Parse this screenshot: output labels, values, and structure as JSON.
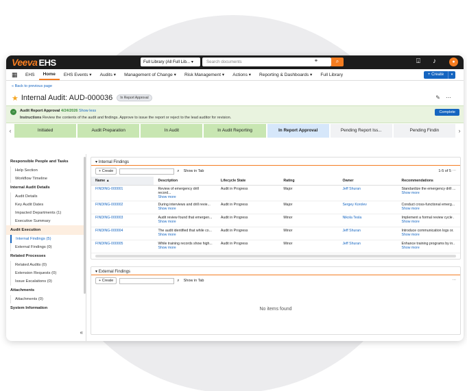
{
  "app": {
    "brand_veeva": "Veeva",
    "brand_ehs": "EHS"
  },
  "topbar": {
    "library": "Full Library (All Full Lib...",
    "search_placeholder": "Search documents"
  },
  "nav": {
    "items": [
      "EHS",
      "Home",
      "EHS Events ▾",
      "Audits ▾",
      "Management of Change ▾",
      "Risk Management ▾",
      "Actions ▾",
      "Reporting & Dashboards ▾",
      "Full Library"
    ],
    "create": "+ Create"
  },
  "page": {
    "back": "« Back to previous page",
    "title": "Internal Audit: AUD-000036",
    "badge": "In Report Approval"
  },
  "approval": {
    "label": "Audit Report Approval",
    "date": "4/24/2026",
    "show_less": "Show less",
    "instructions_label": "Instructions",
    "instructions": "Review the contents of the audit and findings. Approve to issue the report or reject to the lead auditor for revision.",
    "complete": "Complete"
  },
  "stages": [
    "Initiated",
    "Audit Preparation",
    "In Audit",
    "In Audit Reporting",
    "In Report Approval",
    "Pending Report Iss...",
    "Pending Findin"
  ],
  "sidebar": {
    "sections": [
      {
        "title": "Responsible People and Tasks",
        "items": [
          "Help Section",
          "Workflow Timeline"
        ]
      },
      {
        "title": "Internal Audit Details",
        "items": [
          "Audit Details",
          "Key Audit Dates",
          "Impacted Departments (1)",
          "Executive Summary"
        ]
      },
      {
        "title": "Audit Execution",
        "items": [
          "Internal Findings (5)",
          "External Findings (0)"
        ]
      },
      {
        "title": "Related Processes",
        "items": [
          "Related Audits (0)",
          "Extension Requests (0)",
          "Issue Escalations (0)"
        ]
      },
      {
        "title": "Attachments",
        "items": [
          "Attachments (0)"
        ]
      },
      {
        "title": "System Information",
        "items": []
      }
    ]
  },
  "internal": {
    "title": "Internal Findings",
    "create": "+ Create",
    "show_in_tab": "Show in Tab",
    "count": "1-5 of 5",
    "columns": [
      "Name ▲",
      "Description",
      "Lifecycle State",
      "Rating",
      "Owner",
      "Recommendations"
    ],
    "show_more": "Show more",
    "rows": [
      [
        "FINDING-000001",
        "Review of emergency drill record...",
        "Audit in Progress",
        "Major",
        "Jeff Shuran",
        "Standardize the emergency drill ..."
      ],
      [
        "FINDING-000002",
        "During interviews and drill revie...",
        "Audit in Progress",
        "Major",
        "Sergey Korolev",
        "Conduct cross-functional emerg..."
      ],
      [
        "FINDING-000003",
        "Audit review found that emergen...",
        "Audit in Progress",
        "Minor",
        "Nikola Tesla",
        "Implement a formal review cycle ."
      ],
      [
        "FINDING-000004",
        "The audit identified that while co...",
        "Audit in Progress",
        "Minor",
        "Jeff Shuran",
        "Introduce communication logs or."
      ],
      [
        "FINDING-000005",
        "While training records show high...",
        "Audit in Progress",
        "Minor",
        "Jeff Shuran",
        "Enhance training programs by in.."
      ]
    ]
  },
  "external": {
    "title": "External Findings",
    "create": "+ Create",
    "show_in_tab": "Show in Tab",
    "empty": "No items found"
  }
}
